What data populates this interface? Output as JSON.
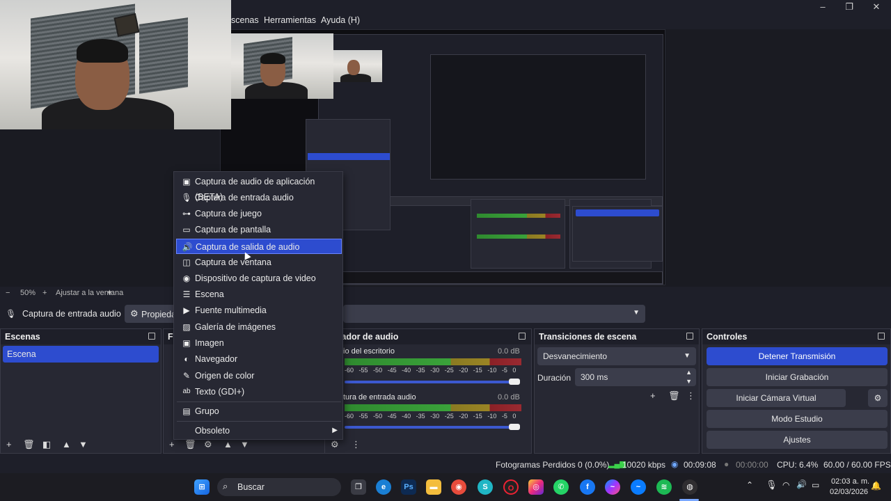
{
  "menu": {
    "escenas": "scenas",
    "herramientas": "Herramientas",
    "ayuda": "Ayuda (H)"
  },
  "window_controls": {
    "minimize": "–",
    "maximize": "❐",
    "close": "✕"
  },
  "zoom": {
    "minus": "−",
    "level": "50%",
    "plus": "+",
    "fit": "Ajustar a la ventana",
    "arrow": "▼"
  },
  "source_bar": {
    "source_name": "Captura de entrada audio",
    "properties": "Propieda"
  },
  "context_menu": {
    "items": [
      "Captura de audio de aplicación (BETA)",
      "Captura de entrada audio",
      "Captura de juego",
      "Captura de pantalla",
      "Captura de salida de audio",
      "Captura de ventana",
      "Dispositivo de captura de video",
      "Escena",
      "Fuente multimedia",
      "Galería de imágenes",
      "Imagen",
      "Navegador",
      "Origen de color",
      "Texto (GDI+)",
      "Grupo",
      "Obsoleto"
    ],
    "selected": "Captura de salida de audio",
    "submenu_arrow": "▶"
  },
  "docks": {
    "scenes": {
      "title": "Escenas",
      "items": [
        "Escena"
      ]
    },
    "sources": {
      "title": "Fu"
    },
    "mixer": {
      "title": "xclador de audio",
      "channels": [
        {
          "name": "io del escritorio",
          "db": "0.0 dB"
        },
        {
          "name": "tura de entrada audio",
          "db": "0.0 dB"
        }
      ],
      "scale": [
        "-60",
        "-55",
        "-50",
        "-45",
        "-40",
        "-35",
        "-30",
        "-25",
        "-20",
        "-15",
        "-10",
        "-5",
        "0"
      ]
    },
    "transitions": {
      "title": "Transiciones de escena",
      "transition": "Desvanecimiento",
      "duration_label": "Duración",
      "duration": "300 ms"
    },
    "controls": {
      "title": "Controles",
      "buttons": [
        "Detener Transmisión",
        "Iniciar Grabación",
        "Iniciar Cámara Virtual",
        "Modo Estudio",
        "Ajustes"
      ]
    }
  },
  "status": {
    "dropped": "Fotogramas Perdidos 0 (0.0%)",
    "bitrate": "10020 kbps",
    "stream_time": "00:09:08",
    "rec_time": "00:00:00",
    "cpu": "CPU: 6.4%",
    "fps": "60.00 / 60.00 FPS"
  },
  "taskbar": {
    "search": "Buscar",
    "time": "02:03 a. m.",
    "date": "02/03/2026"
  },
  "colors": {
    "accent": "#2d4ccf",
    "background": "#1e1f29",
    "panel": "#272833",
    "button": "#3b3d4b"
  }
}
